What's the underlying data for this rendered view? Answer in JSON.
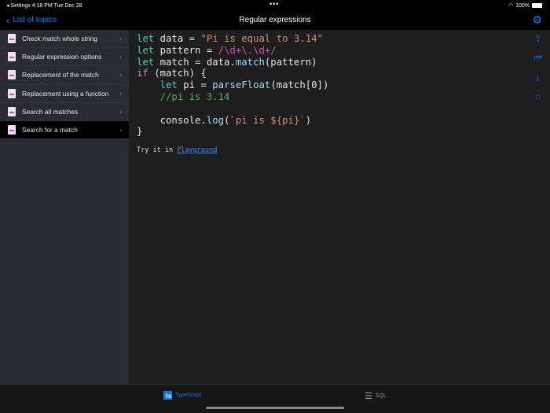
{
  "status": {
    "left": "◂ Settings   4:18 PM   Tue Dec 28",
    "battery": "100%"
  },
  "nav": {
    "back": "List of topics",
    "title": "Regular expressions"
  },
  "sidebar": {
    "items": [
      {
        "label": "Check match whole string"
      },
      {
        "label": "Regular expression options"
      },
      {
        "label": "Replacement of the match"
      },
      {
        "label": "Replacement using a function"
      },
      {
        "label": "Search all matches"
      },
      {
        "label": "Search for a match",
        "selected": true
      }
    ]
  },
  "code": [
    [
      [
        "kw",
        "let"
      ],
      [
        "",
        "data = "
      ],
      [
        "str",
        "\"Pi is equal to 3.14\""
      ]
    ],
    [
      [
        "kw",
        "let"
      ],
      [
        "",
        "pattern = "
      ],
      [
        "re",
        "/\\d+\\.\\d+/"
      ]
    ],
    [
      [
        "kw",
        "let"
      ],
      [
        "",
        "match = data."
      ],
      [
        "fn",
        "match"
      ],
      [
        "",
        "(pattern)"
      ]
    ],
    [
      [
        "kw2",
        "if"
      ],
      [
        "",
        " (match) {"
      ]
    ],
    [
      [
        "",
        "    "
      ],
      [
        "kw",
        "let"
      ],
      [
        "",
        " pi = "
      ],
      [
        "fn",
        "parseFloat"
      ],
      [
        "",
        "(match[0])"
      ]
    ],
    [
      [
        "cm",
        "    //pi is 3.14"
      ]
    ],
    [
      [
        "",
        ""
      ]
    ],
    [
      [
        "",
        "    console."
      ],
      [
        "fn",
        "log"
      ],
      [
        "",
        "("
      ],
      [
        "tpl",
        "`pi is ${pi}`"
      ],
      [
        "",
        ")"
      ]
    ],
    [
      [
        "",
        "}"
      ]
    ]
  ],
  "try": {
    "prefix": "Try it in ",
    "link": "Playground"
  },
  "tabs": {
    "typescript": "TypeScript",
    "ts_badge": "TS",
    "sql": "SQL"
  }
}
